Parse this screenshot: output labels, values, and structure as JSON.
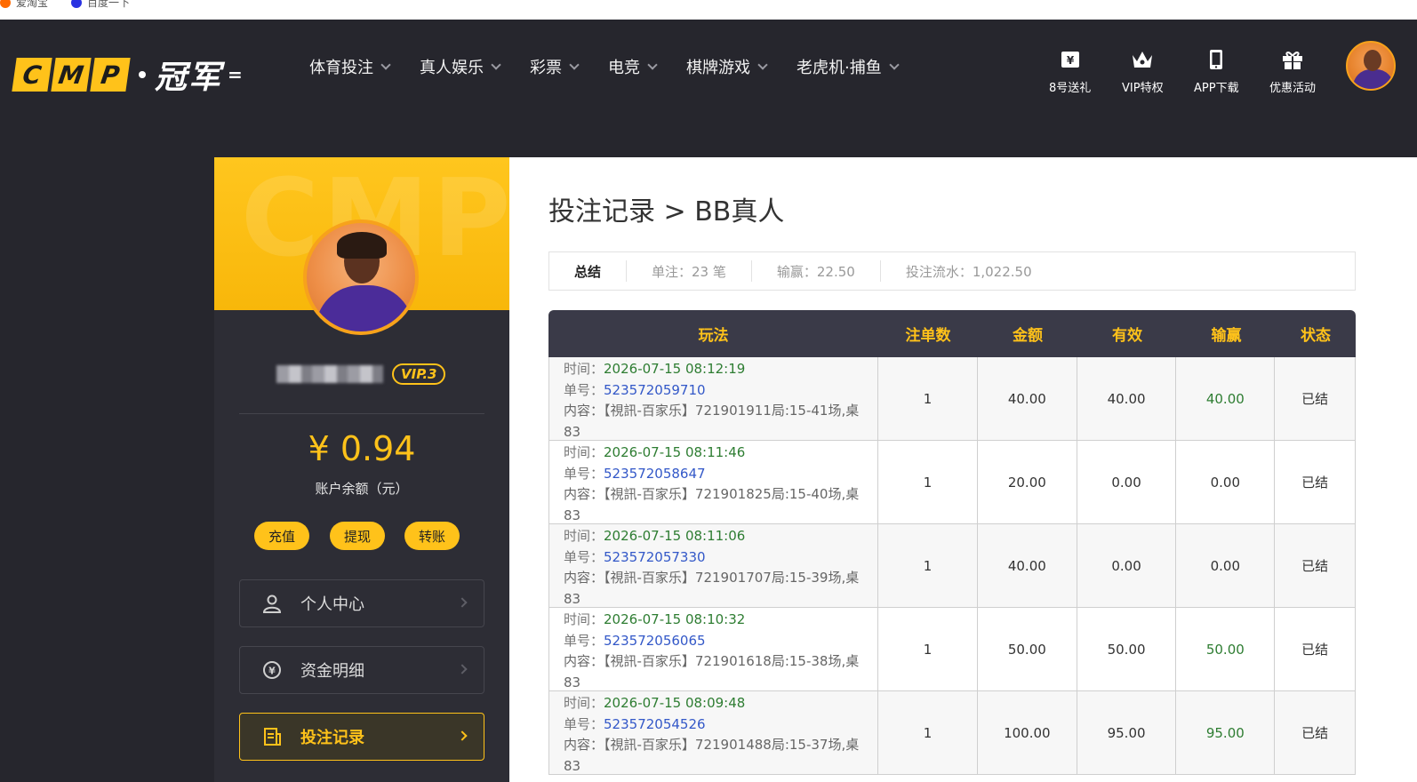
{
  "bookmarks": [
    "爱淘宝",
    "百度一下"
  ],
  "header": {
    "logo_letters": [
      "C",
      "M",
      "P"
    ],
    "logo_cn": "冠军",
    "logo_suffix": "=",
    "nav": [
      "体育投注",
      "真人娱乐",
      "彩票",
      "电竞",
      "棋牌游戏",
      "老虎机·捕鱼"
    ],
    "quick_links": [
      "8号送礼",
      "VIP特权",
      "APP下载",
      "优惠活动"
    ]
  },
  "sidebar": {
    "watermark": "CMP",
    "vip_label": "VIP.3",
    "balance": "¥ 0.94",
    "balance_label": "账户余额（元）",
    "actions": [
      "充值",
      "提现",
      "转账"
    ],
    "menu": [
      "个人中心",
      "资金明细",
      "投注记录"
    ]
  },
  "main": {
    "title": "投注记录 > BB真人",
    "summary": {
      "label": "总结",
      "bets": "单注：23 笔",
      "winloss": "输赢：22.50",
      "turnover": "投注流水：1,022.50"
    },
    "columns": [
      "玩法",
      "注单数",
      "金额",
      "有效",
      "输赢",
      "状态"
    ],
    "row_labels": {
      "time": "时间：",
      "order": "单号：",
      "content": "内容："
    },
    "rows": [
      {
        "time": "2026-07-15 08:12:19",
        "order": "523572059710",
        "content": "【視訊-百家乐】721901911局:15-41场,桌83",
        "count": "1",
        "amount": "40.00",
        "valid": "40.00",
        "winloss": "40.00",
        "status": "已结"
      },
      {
        "time": "2026-07-15 08:11:46",
        "order": "523572058647",
        "content": "【視訊-百家乐】721901825局:15-40场,桌83",
        "count": "1",
        "amount": "20.00",
        "valid": "0.00",
        "winloss": "0.00",
        "status": "已结"
      },
      {
        "time": "2026-07-15 08:11:06",
        "order": "523572057330",
        "content": "【視訊-百家乐】721901707局:15-39场,桌83",
        "count": "1",
        "amount": "40.00",
        "valid": "0.00",
        "winloss": "0.00",
        "status": "已结"
      },
      {
        "time": "2026-07-15 08:10:32",
        "order": "523572056065",
        "content": "【視訊-百家乐】721901618局:15-38场,桌83",
        "count": "1",
        "amount": "50.00",
        "valid": "50.00",
        "winloss": "50.00",
        "status": "已结"
      },
      {
        "time": "2026-07-15 08:09:48",
        "order": "523572054526",
        "content": "【視訊-百家乐】721901488局:15-37场,桌83",
        "count": "1",
        "amount": "100.00",
        "valid": "95.00",
        "winloss": "95.00",
        "status": "已结"
      }
    ]
  },
  "colors": {
    "accent": "#ffc21a",
    "header_bg": "#26262d",
    "table_head": "#3a3a48",
    "win_green": "#2e7d32",
    "order_blue": "#3358c8"
  }
}
